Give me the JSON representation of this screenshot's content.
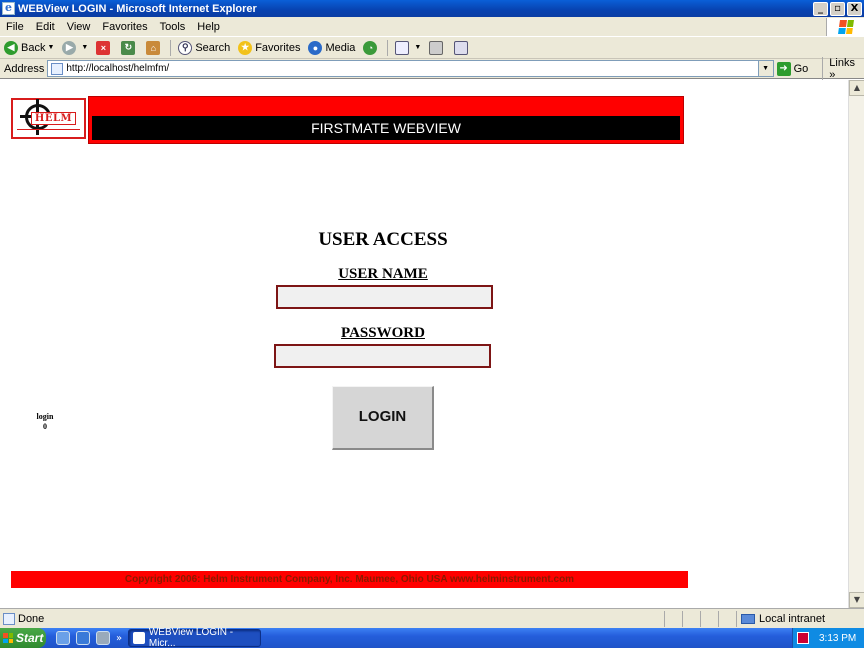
{
  "window": {
    "title": "WEBView LOGIN - Microsoft Internet Explorer",
    "controls": [
      "_",
      "▫",
      "X"
    ]
  },
  "menu": {
    "items": [
      "File",
      "Edit",
      "View",
      "Favorites",
      "Tools",
      "Help"
    ]
  },
  "toolbar": {
    "back_label": "Back",
    "search_label": "Search",
    "favorites_label": "Favorites",
    "media_label": "Media"
  },
  "address": {
    "label": "Address",
    "url": "http://localhost/helmfm/",
    "go_label": "Go",
    "links_label": "Links"
  },
  "page": {
    "logo_text": "HELM",
    "banner_title": "FIRSTMATE WEBVIEW",
    "access_title": "USER ACCESS",
    "username_label": "USER NAME",
    "username_value": "",
    "password_label": "PASSWORD",
    "password_value": "",
    "login_button": "LOGIN",
    "debug_label": "login",
    "debug_value": "0",
    "footer": "Copyright 2006: Helm Instrument Company, Inc.   Maumee, Ohio USA  www.helminstrument.com"
  },
  "status": {
    "text": "Done",
    "zone": "Local intranet"
  },
  "taskbar": {
    "start_label": "Start",
    "task_label": "WEBView LOGIN - Micr...",
    "clock": "3:13 PM"
  },
  "colors": {
    "banner_red": "#ff0000",
    "banner_black": "#000000",
    "input_border": "#7d1515"
  }
}
